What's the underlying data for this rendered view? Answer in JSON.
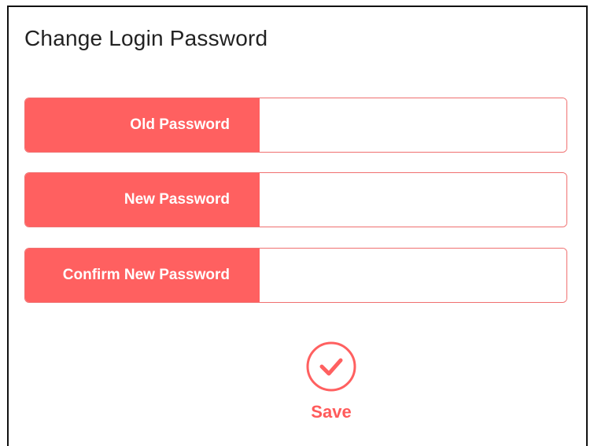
{
  "page": {
    "title": "Change Login Password"
  },
  "form": {
    "fields": [
      {
        "label": "Old Password",
        "value": "",
        "placeholder": ""
      },
      {
        "label": "New Password",
        "value": "",
        "placeholder": ""
      },
      {
        "label": "Confirm New Password",
        "value": "",
        "placeholder": ""
      }
    ],
    "save_label": "Save",
    "save_icon": "check-circle-icon"
  },
  "colors": {
    "accent": "#ff6060",
    "border": "#f07070",
    "save_text": "#ff5a5a"
  }
}
